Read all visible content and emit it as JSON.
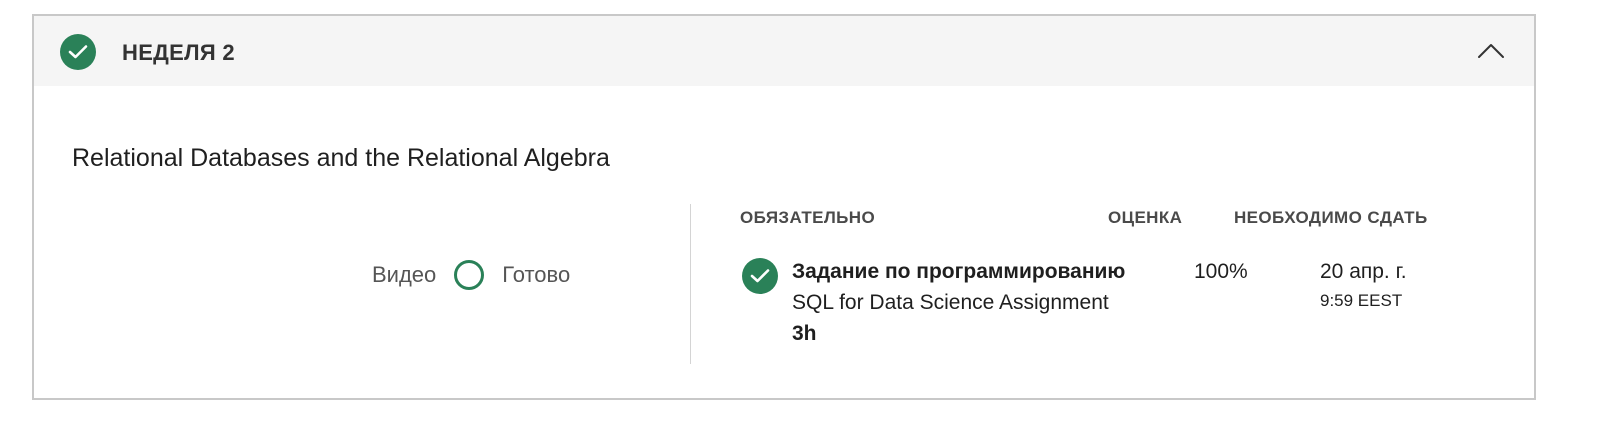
{
  "week": {
    "title": "НЕДЕЛЯ 2",
    "status_icon": "check-icon",
    "toggle_icon": "chevron-up-icon"
  },
  "module": {
    "title": "Relational Databases and the Relational Algebra",
    "video": {
      "label": "Видео",
      "status_label": "Готово"
    }
  },
  "assignments": {
    "headers": {
      "required": "ОБЯЗАТЕЛЬНО",
      "grade": "ОЦЕНКА",
      "due": "НЕОБХОДИМО СДАТЬ"
    },
    "items": [
      {
        "type": "Задание по программированию",
        "name": "SQL for Data Science Assignment",
        "duration": "3h",
        "grade": "100%",
        "due_date": "20 апр. г.",
        "due_time": "9:59 EEST",
        "status_icon": "check-icon"
      }
    ]
  },
  "colors": {
    "accent": "#2a8158",
    "header_bg": "#f5f5f5",
    "border": "#c8c8c8"
  }
}
